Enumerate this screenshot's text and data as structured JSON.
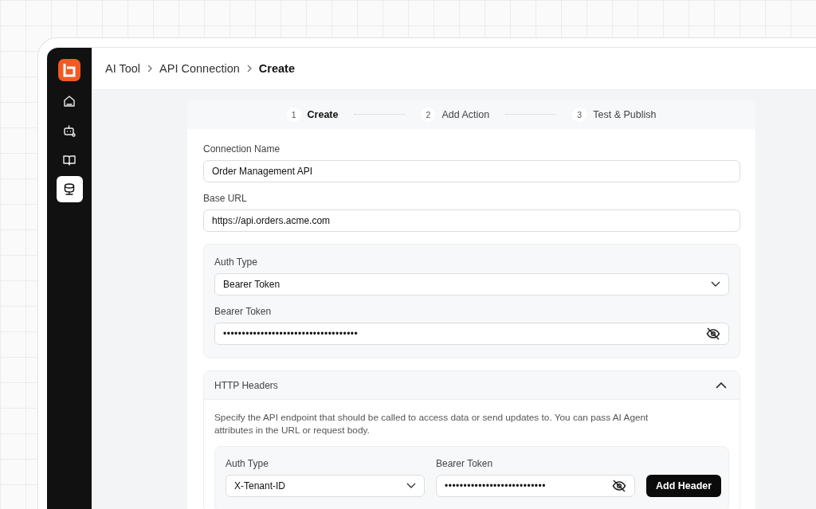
{
  "sidebar": {
    "items": [
      {
        "kind": "home",
        "selected": false
      },
      {
        "kind": "bot",
        "selected": false
      },
      {
        "kind": "book",
        "selected": false
      },
      {
        "kind": "database",
        "selected": true
      }
    ]
  },
  "breadcrumb": [
    "AI Tool",
    "API Connection",
    "Create"
  ],
  "steps": [
    {
      "number": "1",
      "label": "Create",
      "selected": true
    },
    {
      "number": "2",
      "label": "Add Action",
      "selected": false
    },
    {
      "number": "3",
      "label": "Test & Publish",
      "selected": false
    }
  ],
  "form": {
    "connection_name": {
      "label": "Connection Name",
      "value": "Order Management API"
    },
    "base_url": {
      "label": "Base URL",
      "value": "https://api.orders.acme.com"
    },
    "auth": {
      "type_label": "Auth Type",
      "type_value": "Bearer Token",
      "token_label": "Bearer Token",
      "token_value": "••••••••••••••••••••••••••••••••••••"
    },
    "headers": {
      "title": "HTTP Headers",
      "expanded": true,
      "description": "Specify the API endpoint that should be called to access data or send updates to. You can pass AI Agent attributes in the URL or request body.",
      "type_label": "Auth Type",
      "type_value": "X-Tenant-ID",
      "token_label": "Bearer Token",
      "token_value": "•••••••••••••••••••••••••••",
      "button": "Add Header"
    }
  }
}
